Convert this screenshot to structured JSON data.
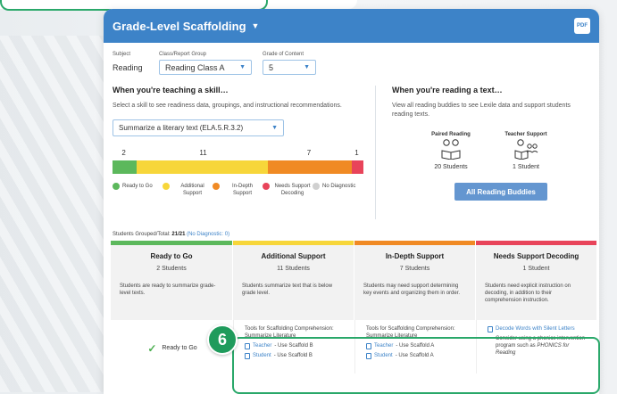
{
  "header": {
    "title": "Grade-Level Scaffolding",
    "pdf_label": "PDF"
  },
  "filters": {
    "subject_label": "Subject",
    "subject_value": "Reading",
    "group_label": "Class/Report Group",
    "group_value": "Reading Class A",
    "grade_label": "Grade of Content",
    "grade_value": "5"
  },
  "teaching": {
    "title": "When you're teaching a skill…",
    "desc": "Select a skill to see readiness data, groupings, and instructional recommendations.",
    "skill": "Summarize a literary text (ELA.5.R.3.2)"
  },
  "chart_data": {
    "type": "bar",
    "categories": [
      "Ready to Go",
      "Additional Support",
      "In-Depth Support",
      "Needs Support Decoding",
      "No Diagnostic"
    ],
    "values": [
      2,
      11,
      7,
      1,
      0
    ],
    "colors": [
      "#5cb85c",
      "#f7d63a",
      "#f08a24",
      "#e8445a",
      "#d0d0d0"
    ]
  },
  "legend": [
    {
      "label": "Ready to Go",
      "color": "#5cb85c"
    },
    {
      "label": "Additional Support",
      "color": "#f7d63a"
    },
    {
      "label": "In-Depth Support",
      "color": "#f08a24"
    },
    {
      "label": "Needs Support Decoding",
      "color": "#e8445a"
    },
    {
      "label": "No Diagnostic",
      "color": "#d0d0d0"
    }
  ],
  "reading": {
    "title": "When you're reading a text…",
    "desc": "View all reading buddies to see Lexile data and support students reading texts.",
    "paired_label": "Paired Reading",
    "paired_count": "20 Students",
    "teacher_label": "Teacher Support",
    "teacher_count": "1 Student",
    "button": "All Reading Buddies"
  },
  "grouped": {
    "prefix": "Students Grouped/Total:",
    "value": "21/21",
    "nodiag": "(No Diagnostic: 0)"
  },
  "groups": [
    {
      "title": "Ready to Go",
      "count": "2 Students",
      "desc": "Students are ready to summarize grade-level texts.",
      "color": "#5cb85c",
      "ready": "Ready to Go"
    },
    {
      "title": "Additional Support",
      "count": "11 Students",
      "desc": "Students summarize text that is below grade level.",
      "color": "#f7d63a",
      "tools": "Tools for Scaffolding Comprehension: Summarize Literature",
      "link1": "Teacher",
      "link1_rest": " - Use Scaffold B",
      "link2": "Student",
      "link2_rest": " - Use Scaffold B"
    },
    {
      "title": "In-Depth Support",
      "count": "7 Students",
      "desc": "Students may need support determining key events and organizing them in order.",
      "color": "#f08a24",
      "tools": "Tools for Scaffolding Comprehension: Summarize Literature",
      "link1": "Teacher",
      "link1_rest": " - Use Scaffold A",
      "link2": "Student",
      "link2_rest": " - Use Scaffold A"
    },
    {
      "title": "Needs Support Decoding",
      "count": "1 Student",
      "desc": "Students need explicit instruction on decoding, in addition to their comprehension instruction.",
      "color": "#e8445a",
      "link": "Decode Words with Silent Letters",
      "note": "Consider using a phonics intervention program such as",
      "note_em": "PHONICS for Reading"
    }
  ],
  "callout": {
    "number": "6"
  }
}
